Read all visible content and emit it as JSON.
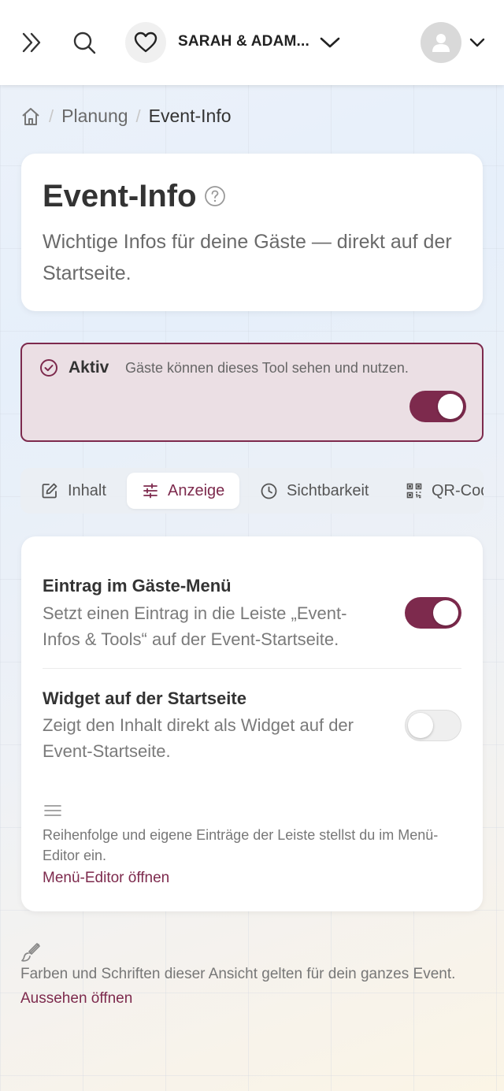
{
  "topbar": {
    "event_name": "SARAH & ADAM...",
    "icons": [
      "chevrons-right-icon",
      "search-icon",
      "heart-icon",
      "chevron-down-icon",
      "avatar-icon",
      "chevron-down-icon"
    ]
  },
  "breadcrumb": {
    "home_icon": "home-icon",
    "items": [
      "Planung",
      "Event-Info"
    ]
  },
  "header": {
    "title": "Event-Info",
    "subtitle": "Wichtige Infos für deine Gäste — direkt auf der Startseite."
  },
  "status": {
    "label": "Aktiv",
    "description": "Gäste können dieses Tool sehen und nutzen.",
    "enabled": true
  },
  "tabs": [
    {
      "label": "Inhalt",
      "icon": "edit-icon"
    },
    {
      "label": "Anzeige",
      "icon": "sliders-icon",
      "active": true
    },
    {
      "label": "Sichtbarkeit",
      "icon": "clock-icon"
    },
    {
      "label": "QR-Code",
      "icon": "qr-code-icon"
    }
  ],
  "settings": {
    "menu_entry": {
      "title": "Eintrag im Gäste-Menü",
      "description": "Setzt einen Eintrag in die Leiste „Event-Infos & Tools“ auf der Event-Startseite.",
      "enabled": true
    },
    "widget": {
      "title": "Widget auf der Startseite",
      "description": "Zeigt den Inhalt direkt als Widget auf der Event-Startseite.",
      "enabled": false
    },
    "menu_note": "Reihenfolge und eigene Einträge der Leiste stellst du im Menü-Editor ein.",
    "menu_link": "Menü-Editor öffnen"
  },
  "footer": {
    "note": "Farben und Schriften dieser Ansicht gelten für dein ganzes Event.",
    "link": "Aussehen öffnen"
  },
  "colors": {
    "accent": "#7d2a4d",
    "status_bg": "#ebdfe4"
  }
}
